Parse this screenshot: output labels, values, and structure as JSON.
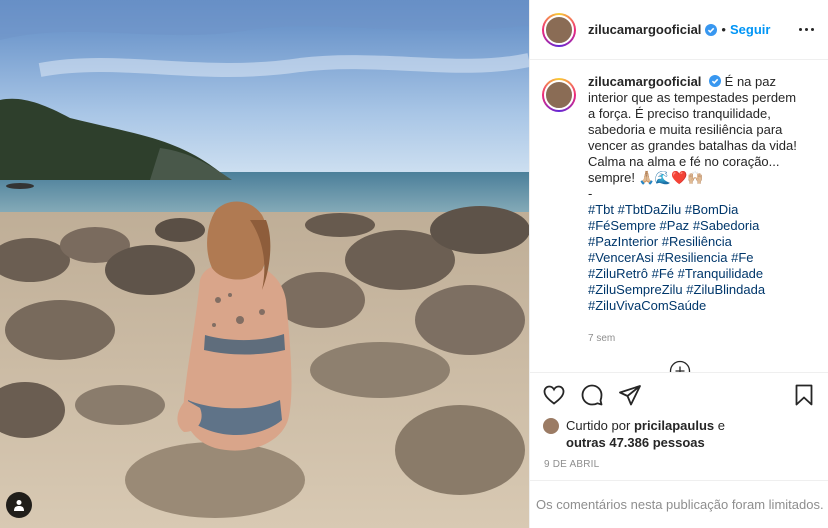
{
  "header": {
    "username": "zilucamargooficial",
    "separator": "•",
    "follow_label": "Seguir"
  },
  "caption": {
    "username": "zilucamargooficial",
    "text": "É na paz interior que as tempestades perdem a força. É preciso tranquilidade, sabedoria e muita resiliência para vencer as grandes batalhas da vida! Calma na alma e fé no coração... sempre! 🙏🏼🌊❤️🙌🏼\n-",
    "hashtags": [
      "#Tbt",
      "#TbtDaZilu",
      "#BomDia",
      "#FéSempre",
      "#Paz",
      "#Sabedoria",
      "#PazInterior",
      "#Resiliência",
      "#VencerAsi",
      "#Resiliencia",
      "#Fe",
      "#ZiluRetrô",
      "#Fé",
      "#Tranquilidade",
      "#ZiluSempreZilu",
      "#ZiluBlindada",
      "#ZiluVivaComSaúde"
    ],
    "age": "7 sem"
  },
  "likes": {
    "prefix": "Curtido por",
    "user": "pricilapaulus",
    "mid": "e",
    "others": "outras 47.386 pessoas"
  },
  "date": "9 DE ABRIL",
  "footer": {
    "limited_text": "Os comentários nesta publicação foram limitados."
  },
  "icons": {
    "like": "heart-icon",
    "comment": "comment-icon",
    "share": "share-icon",
    "save": "bookmark-icon",
    "more": "more-options-icon",
    "load_more": "plus-circle-icon",
    "tags": "user-tag-icon",
    "verified": "verified-badge-icon"
  },
  "colors": {
    "link_blue": "#0095f6",
    "hashtag": "#00376b",
    "muted": "#8e8e8e",
    "verified": "#3897f0"
  }
}
